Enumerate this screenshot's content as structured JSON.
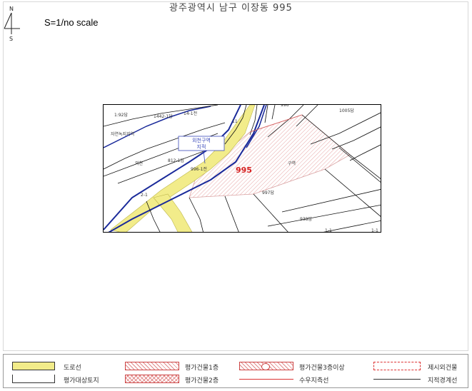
{
  "header": {
    "title": "광주광역시 남구 이장동 995",
    "scale": "S=1/no scale",
    "north_n": "N",
    "north_s": "S"
  },
  "map": {
    "parcel_main": "995",
    "callout": [
      "외천구역",
      "지적"
    ],
    "labels": {
      "l1": "1:92답",
      "l2": "1442-1답",
      "l3": "14-1전",
      "l4": "자연녹지지역",
      "l5": "996",
      "l6": "1005답",
      "l7": "외천",
      "l8": "812-1임",
      "l9": "996-1전",
      "l10": "2-1",
      "l11": "997답",
      "l12": "938답",
      "l13": "1-1",
      "l14": "11",
      "l15": "1-1",
      "l16": "구역"
    },
    "colors": {
      "road": "#f2ec8a",
      "blue_line": "#1a2a9a",
      "highlight": "#d65b5b",
      "parcel_text": "#d62020"
    }
  },
  "legend": {
    "items": [
      {
        "label": "도로선"
      },
      {
        "label": "평가건물1층"
      },
      {
        "label": "평가건물3층이상"
      },
      {
        "label": "제시외건물"
      },
      {
        "label": "평가대상토지"
      },
      {
        "label": "평가건물2층"
      },
      {
        "label": "수우지측선"
      },
      {
        "label": "지적경계선"
      }
    ]
  }
}
